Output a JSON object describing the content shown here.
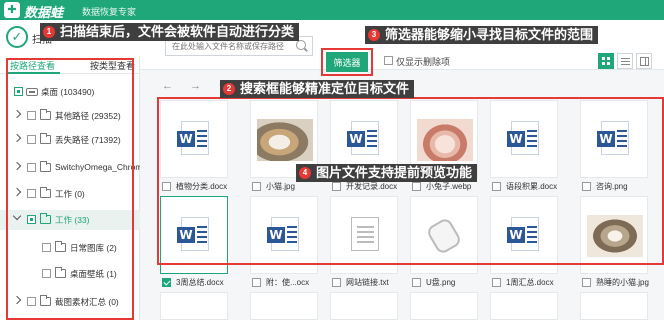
{
  "app": {
    "logo_glyph": "✚",
    "name": "数据蛙",
    "subtitle": "数据恢复专家"
  },
  "toolbar": {
    "status_glyph": "✓",
    "status_text": "扫描",
    "search_placeholder": "在此处输入文件名称或保存路径",
    "filter_button": "筛选器",
    "show_deleted_label": "仅显示删除项"
  },
  "sidebar": {
    "tabs": [
      {
        "label": "按路径查看",
        "active": true
      },
      {
        "label": "按类型查看",
        "active": false
      }
    ],
    "tree": [
      {
        "label": "桌面 (103490)"
      },
      {
        "label": "其他路径 (29352)"
      },
      {
        "label": "丢失路径 (71392)"
      },
      {
        "label": "SwitchyOmega_Chromiur"
      },
      {
        "label": "工作 (0)"
      },
      {
        "label": "工作 (33)"
      },
      {
        "label": "日常图库 (2)"
      },
      {
        "label": "桌面壁纸 (1)"
      },
      {
        "label": "截图素材汇总 (0)"
      }
    ]
  },
  "nav": {
    "back": "←",
    "forward": "→",
    "up": "↑"
  },
  "files": [
    {
      "name": "植物分类.docx",
      "type": "word"
    },
    {
      "name": "小猫.jpg",
      "type": "cat"
    },
    {
      "name": "开发记录.docx",
      "type": "word"
    },
    {
      "name": "小兔子.webp",
      "type": "bunny"
    },
    {
      "name": "语段积累.docx",
      "type": "word"
    },
    {
      "name": "咨询.png",
      "type": "word"
    },
    {
      "name": "3周总结.docx",
      "type": "word"
    },
    {
      "name": "附：使...ocx",
      "type": "word"
    },
    {
      "name": "网站链接.txt",
      "type": "txt"
    },
    {
      "name": "U盘.png",
      "type": "udisk"
    },
    {
      "name": "1周汇总.docx",
      "type": "word"
    },
    {
      "name": "熟睡的小猫.jpg",
      "type": "kitten"
    }
  ],
  "annotations": [
    {
      "num": "1",
      "text": "扫描结束后，文件会被软件自动进行分类"
    },
    {
      "num": "2",
      "text": "搜索框能够精准定位目标文件"
    },
    {
      "num": "3",
      "text": "筛选器能够缩小寻找目标文件的范围"
    },
    {
      "num": "4",
      "text": "图片文件支持提前预览功能"
    }
  ],
  "colors": {
    "accent": "#1fa77a",
    "annotation_red": "#e53935"
  }
}
